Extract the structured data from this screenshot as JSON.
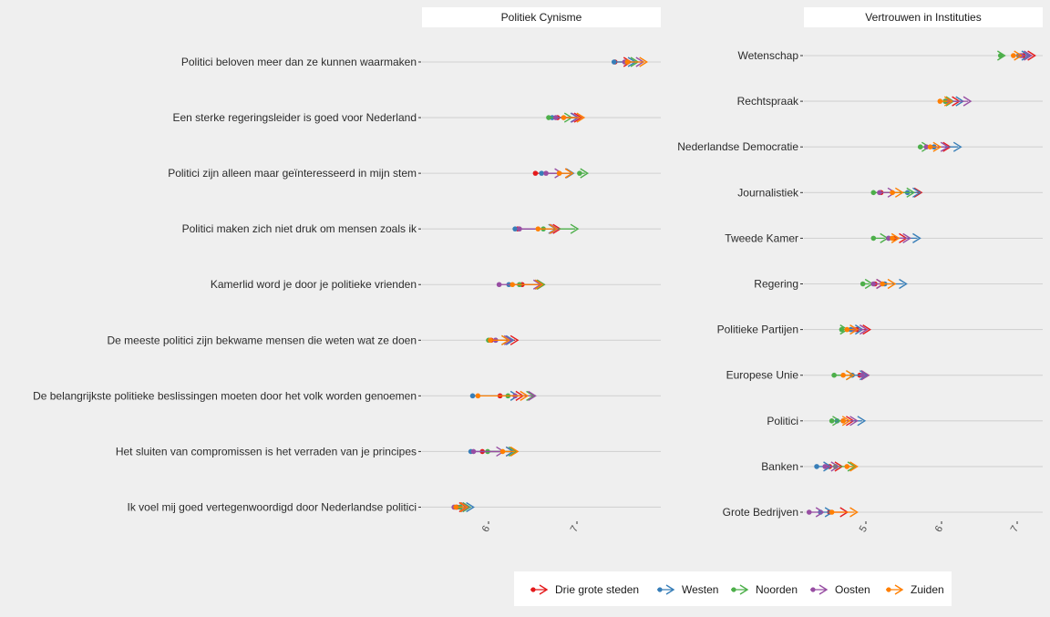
{
  "chart_data": [
    {
      "type": "scatter",
      "facet_title": "Politiek Cynisme",
      "categories": [
        "Politici beloven meer dan ze kunnen waarmaken",
        "Een sterke regeringsleider is goed voor Nederland",
        "Politici zijn alleen maar geïnteresseerd in mijn stem",
        "Politici maken zich niet druk om mensen zoals ik",
        "Kamerlid word je door je politieke vrienden",
        "De meeste politici zijn bekwame mensen die weten wat ze doen",
        "De belangrijkste politieke beslissingen moeten door het volk worden genoemen",
        "Het sluiten van compromissen is het verraden van je principes",
        "Ik voel mij goed vertegenwoordigd door Nederlandse politici"
      ],
      "x_ticks": [
        6,
        7
      ],
      "x_tick_labels": [
        "6",
        "7"
      ],
      "xlim": [
        5.6,
        7.95
      ],
      "series": [
        {
          "name": "Drie grote steden",
          "values": [
            [
              7.43,
              7.58
            ],
            [
              6.78,
              7.02
            ],
            [
              6.53,
              6.92
            ],
            [
              6.33,
              6.78
            ],
            [
              6.38,
              6.6
            ],
            [
              6.03,
              6.3
            ],
            [
              6.13,
              6.36
            ],
            [
              5.93,
              6.25
            ],
            [
              5.64,
              5.72
            ]
          ]
        },
        {
          "name": "Westen",
          "values": [
            [
              7.42,
              7.63
            ],
            [
              6.72,
              6.98
            ],
            [
              6.6,
              6.93
            ],
            [
              6.3,
              6.73
            ],
            [
              6.23,
              6.58
            ],
            [
              6.08,
              6.25
            ],
            [
              5.82,
              6.3
            ],
            [
              5.8,
              6.25
            ],
            [
              5.68,
              5.8
            ]
          ]
        },
        {
          "name": "Noorden",
          "values": [
            [
              7.56,
              7.66
            ],
            [
              6.68,
              6.91
            ],
            [
              7.03,
              7.09
            ],
            [
              6.62,
              6.98
            ],
            [
              6.35,
              6.6
            ],
            [
              6.0,
              6.2
            ],
            [
              6.22,
              6.48
            ],
            [
              5.99,
              6.28
            ],
            [
              5.68,
              5.76
            ]
          ]
        },
        {
          "name": "Oosten",
          "values": [
            [
              7.54,
              7.72
            ],
            [
              6.76,
              6.99
            ],
            [
              6.65,
              6.8
            ],
            [
              6.35,
              6.75
            ],
            [
              6.12,
              6.56
            ],
            [
              6.08,
              6.23
            ],
            [
              6.3,
              6.5
            ],
            [
              5.83,
              6.14
            ],
            [
              5.61,
              5.74
            ]
          ]
        },
        {
          "name": "Zuiden",
          "values": [
            [
              7.57,
              7.76
            ],
            [
              6.85,
              7.05
            ],
            [
              6.8,
              6.92
            ],
            [
              6.56,
              6.74
            ],
            [
              6.27,
              6.58
            ],
            [
              6.02,
              6.2
            ],
            [
              5.88,
              6.41
            ],
            [
              6.16,
              6.3
            ],
            [
              5.63,
              5.73
            ]
          ]
        }
      ]
    },
    {
      "type": "scatter",
      "facet_title": "Vertrouwen in Instituties",
      "categories": [
        "Wetenschap",
        "Rechtspraak",
        "Nederlandse Democratie",
        "Journalistiek",
        "Tweede Kamer",
        "Regering",
        "Politieke Partijen",
        "Europese Unie",
        "Politici",
        "Banken",
        "Grote Bedrijven"
      ],
      "x_ticks": [
        5,
        6,
        7
      ],
      "x_tick_labels": [
        "5",
        "6",
        "7"
      ],
      "xlim": [
        4.2,
        7.35
      ],
      "series": [
        {
          "name": "Drie grote steden",
          "values": [
            [
              7.08,
              7.2
            ],
            [
              6.05,
              6.2
            ],
            [
              5.9,
              6.08
            ],
            [
              5.2,
              5.7
            ],
            [
              5.38,
              5.5
            ],
            [
              5.12,
              5.2
            ],
            [
              4.88,
              5.02
            ],
            [
              4.92,
              5.0
            ],
            [
              4.7,
              4.8
            ],
            [
              4.52,
              4.65
            ],
            [
              4.52,
              4.72
            ]
          ]
        },
        {
          "name": "Westen",
          "values": [
            [
              7.02,
              7.12
            ],
            [
              6.08,
              6.25
            ],
            [
              5.9,
              6.22
            ],
            [
              5.55,
              5.68
            ],
            [
              5.3,
              5.68
            ],
            [
              5.25,
              5.5
            ],
            [
              4.8,
              4.92
            ],
            [
              4.82,
              4.98
            ],
            [
              4.62,
              4.95
            ],
            [
              4.35,
              4.5
            ],
            [
              4.4,
              4.52
            ]
          ]
        },
        {
          "name": "Noorden",
          "values": [
            [
              6.78,
              6.8
            ],
            [
              6.05,
              6.12
            ],
            [
              5.72,
              5.8
            ],
            [
              5.1,
              5.6
            ],
            [
              5.1,
              5.25
            ],
            [
              4.96,
              5.05
            ],
            [
              4.68,
              4.72
            ],
            [
              4.58,
              4.8
            ],
            [
              4.55,
              4.62
            ],
            [
              4.6,
              4.82
            ]
          ]
        },
        {
          "name": "Oosten",
          "values": [
            [
              7.05,
              7.15
            ],
            [
              6.1,
              6.35
            ],
            [
              5.8,
              6.05
            ],
            [
              5.18,
              5.35
            ],
            [
              5.3,
              5.55
            ],
            [
              5.1,
              5.2
            ],
            [
              4.85,
              4.98
            ],
            [
              4.95,
              5.0
            ],
            [
              4.7,
              4.85
            ],
            [
              4.46,
              4.6
            ],
            [
              4.25,
              4.4
            ]
          ]
        },
        {
          "name": "Zuiden",
          "values": [
            [
              6.95,
              7.02
            ],
            [
              5.98,
              6.1
            ],
            [
              5.85,
              5.95
            ],
            [
              5.35,
              5.45
            ],
            [
              5.35,
              5.4
            ],
            [
              5.22,
              5.35
            ],
            [
              4.75,
              4.85
            ],
            [
              4.7,
              4.8
            ],
            [
              4.7,
              4.75
            ],
            [
              4.75,
              4.85
            ],
            [
              4.55,
              4.85
            ]
          ]
        }
      ]
    }
  ],
  "legend_position": "bottom",
  "grid": true,
  "colors": {
    "Drie grote steden": "#e41a1c",
    "Westen": "#377eb8",
    "Noorden": "#4daf4a",
    "Oosten": "#984ea3",
    "Zuiden": "#ff7f00"
  }
}
